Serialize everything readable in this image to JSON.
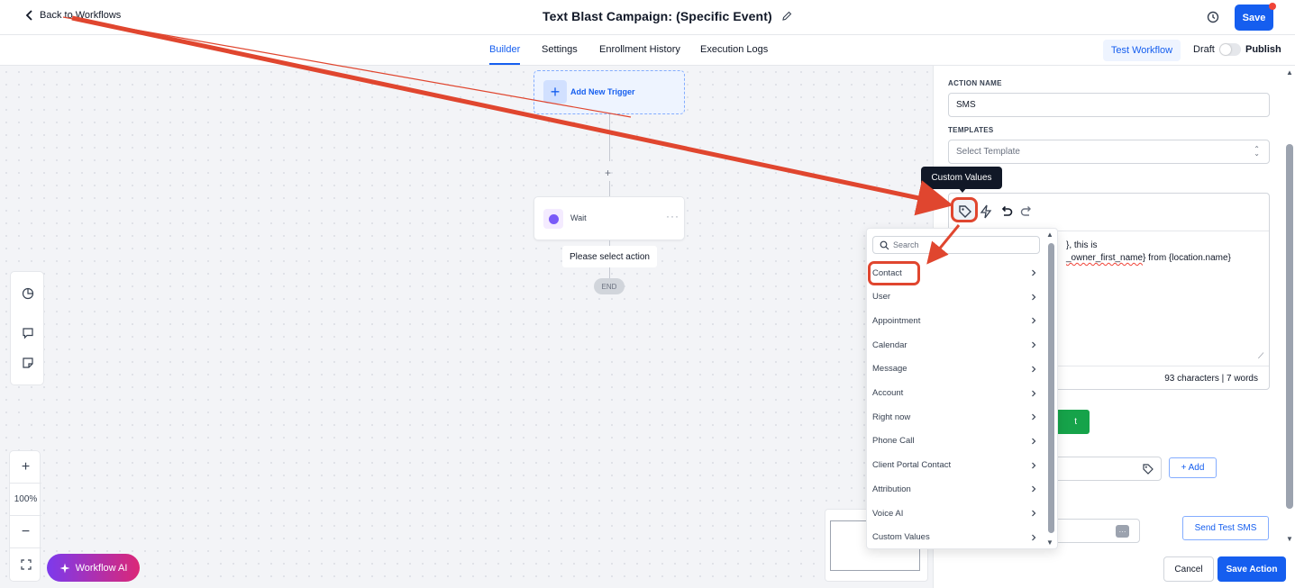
{
  "header": {
    "back_label": "Back to Workflows",
    "title": "Text Blast Campaign: (Specific Event)",
    "save_label": "Save"
  },
  "tabs": [
    {
      "label": "Builder",
      "active": true
    },
    {
      "label": "Settings",
      "active": false
    },
    {
      "label": "Enrollment History",
      "active": false
    },
    {
      "label": "Execution Logs",
      "active": false
    }
  ],
  "toolbar": {
    "test_workflow_label": "Test Workflow",
    "draft_label": "Draft",
    "publish_label": "Publish",
    "published": false
  },
  "canvas": {
    "trigger_label": "Add New Trigger",
    "add_step_symbol": "+",
    "wait_label": "Wait",
    "wait_more": "···",
    "select_action_label": "Please select action",
    "end_label": "END",
    "zoom_in": "+",
    "zoom_level": "100%",
    "zoom_out": "−",
    "workflow_ai_label": "Workflow AI"
  },
  "panel": {
    "action_name_label": "ACTION NAME",
    "action_name_value": "SMS",
    "templates_label": "TEMPLATES",
    "templates_placeholder": "Select Template",
    "message_line1": "}, this is",
    "message_line2_prefix": "_owner_first_name",
    "message_line2_suffix": "} from {location.name}",
    "char_count": "93 characters | 7 words",
    "add_label": "+ Add",
    "phone_chip": "···",
    "send_test_label": "Send Test SMS",
    "cancel_label": "Cancel",
    "save_action_label": "Save Action"
  },
  "tooltip": {
    "label": "Custom Values"
  },
  "dropdown": {
    "search_placeholder": "Search",
    "items": [
      "Contact",
      "User",
      "Appointment",
      "Calendar",
      "Message",
      "Account",
      "Right now",
      "Phone Call",
      "Client Portal Contact",
      "Attribution",
      "Voice AI",
      "Custom Values"
    ],
    "highlighted": "Contact"
  },
  "colors": {
    "primary": "#155eef",
    "annotation": "#e0462f",
    "green": "#16a34a",
    "ai_gradient_start": "#7c3aed",
    "ai_gradient_end": "#db2777"
  }
}
